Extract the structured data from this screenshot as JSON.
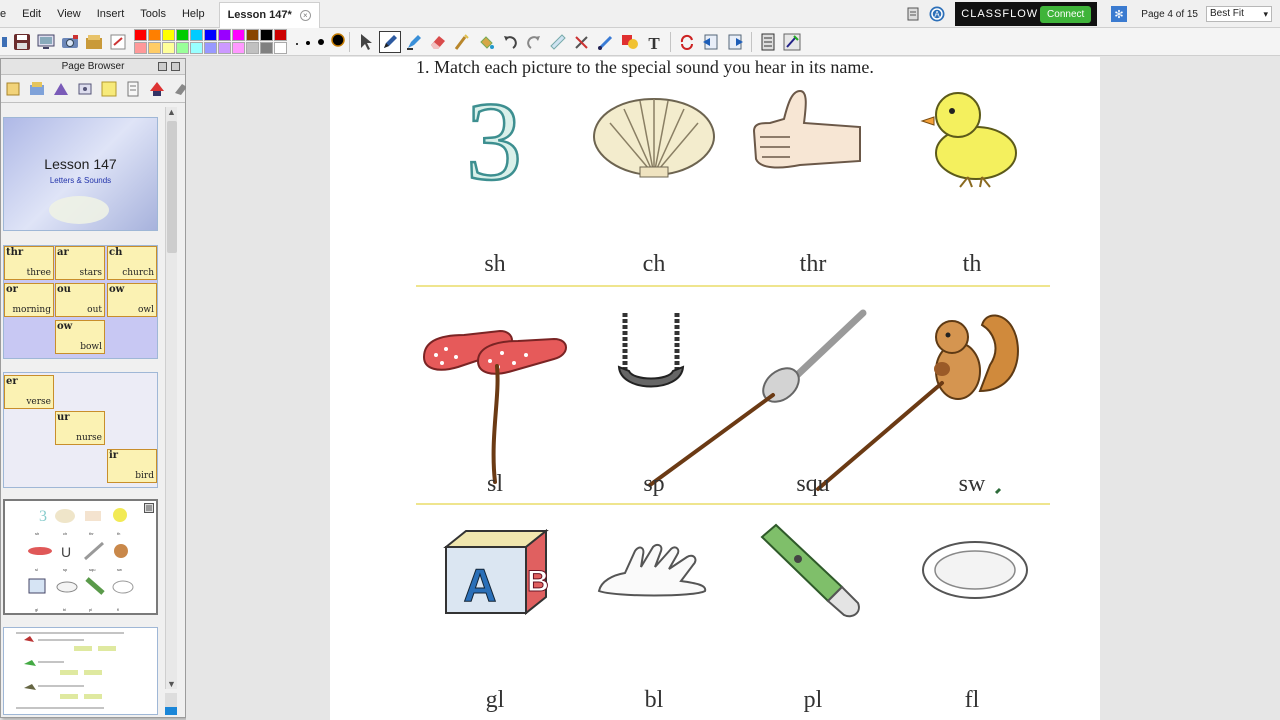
{
  "menubar": {
    "items": [
      "e",
      "Edit",
      "View",
      "Insert",
      "Tools",
      "Help"
    ],
    "doc_tab": "Lesson 147*",
    "classflow": "CLASSFLOW",
    "connect": "Connect",
    "page_indicator": "Page 4 of 15",
    "zoom": "Best Fit"
  },
  "toolbar": {
    "palette": [
      "#ff0000",
      "#ff7f00",
      "#ffff00",
      "#00cc00",
      "#00ccff",
      "#0000ff",
      "#9900ff",
      "#ff00ff",
      "#884400",
      "#000000",
      "#cc0000",
      "#ff9999",
      "#ffcc66",
      "#ffff99",
      "#99ff99",
      "#99ffff",
      "#9999ff",
      "#cc99ff",
      "#ff99ff",
      "#c0c0c0",
      "#808080",
      "#ffffff"
    ]
  },
  "page_browser": {
    "title": "Page Browser",
    "thumb1": {
      "title": "Lesson 147",
      "subtitle": "Letters & Sounds"
    },
    "thumb2_cards": [
      {
        "k": "thr",
        "w": "three"
      },
      {
        "k": "ar",
        "w": "stars"
      },
      {
        "k": "ch",
        "w": "church"
      },
      {
        "k": "or",
        "w": "morning"
      },
      {
        "k": "ou",
        "w": "out"
      },
      {
        "k": "ow",
        "w": "owl"
      },
      {
        "k": "ow",
        "w": "bowl"
      }
    ],
    "thumb3_cards": [
      {
        "k": "er",
        "w": "verse"
      },
      {
        "k": "ur",
        "w": "nurse"
      },
      {
        "k": "ir",
        "w": "bird"
      }
    ],
    "thumb4_words": [
      "sh",
      "ch",
      "thr",
      "th",
      "sl",
      "sp",
      "squ",
      "sw",
      "gl",
      "bl",
      "pl",
      "fl"
    ]
  },
  "page": {
    "instruction": "1. Match each picture to the special sound you hear in its name.",
    "row1_words": [
      "sh",
      "ch",
      "thr",
      "th"
    ],
    "row2_words": [
      "sl",
      "sp",
      "squ",
      "sw"
    ],
    "row3_words": [
      "gl",
      "bl",
      "pl",
      "fl"
    ]
  }
}
